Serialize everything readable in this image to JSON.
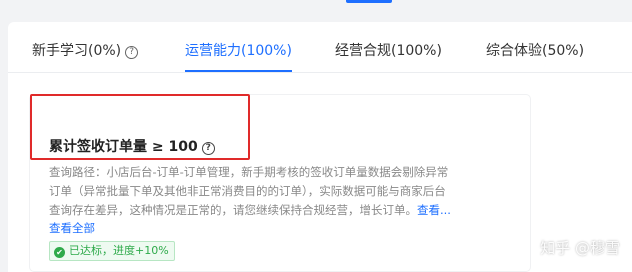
{
  "tabs": [
    {
      "label": "新手学习(0%)",
      "help_icon": "question-circle-icon",
      "active": false
    },
    {
      "label": "运营能力(100%)",
      "help_icon": "",
      "active": true
    },
    {
      "label": "经营合规(100%)",
      "help_icon": "",
      "active": false
    },
    {
      "label": "综合体验(50%)",
      "help_icon": "",
      "active": false
    }
  ],
  "metric": {
    "title": "累计签收订单量 ≥ 100",
    "help_icon": "question-circle-icon",
    "description_lines": [
      "查询路径：小店后台-订单-订单管理，新手期考核的签收订单量数据会剔除异常",
      "订单（异常批量下单及其他非正常消费目的的订单），实际数据可能与商家后台",
      "查询存在差异，这种情况是正常的，请您继续保持合规经营，增长订单。"
    ],
    "more_label": "查看...",
    "view_all_label": "查看全部",
    "status_label": "已达标，进度+10%"
  },
  "watermark": "知乎 @穆雪",
  "colors": {
    "accent": "#1e6fff",
    "highlight_border": "#e02a2a",
    "success": "#2faa4b"
  }
}
